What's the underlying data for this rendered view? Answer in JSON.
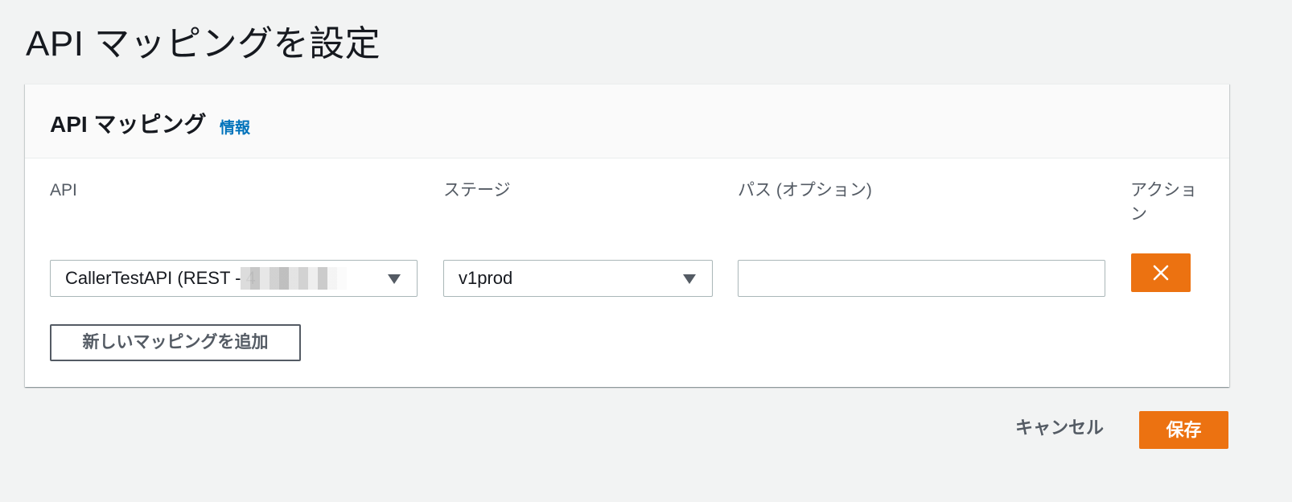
{
  "page": {
    "title": "API マッピングを設定"
  },
  "panel": {
    "title": "API マッピング",
    "info_link": "情報",
    "columns": {
      "api": "API",
      "stage": "ステージ",
      "path": "パス (オプション)",
      "actions": "アクション"
    },
    "mapping_row": {
      "api_value": "CallerTestAPI (REST - 4",
      "stage_value": "v1prod",
      "path_value": "",
      "path_placeholder": ""
    },
    "add_button_label": "新しいマッピングを追加"
  },
  "footer": {
    "cancel_label": "キャンセル",
    "save_label": "保存"
  },
  "colors": {
    "accent": "#ec7211",
    "link": "#0073bb",
    "text": "#16191f",
    "muted": "#545b64",
    "background": "#f2f3f3"
  },
  "icons": {
    "remove": "close-icon",
    "dropdown": "caret-down-icon"
  }
}
